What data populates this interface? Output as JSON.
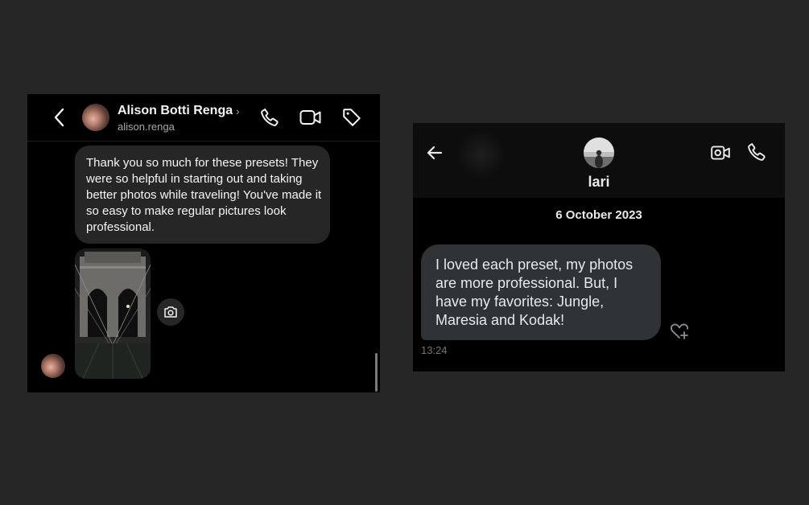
{
  "instagram_dm": {
    "header": {
      "contact_name": "Alison Botti Renga",
      "chevron": "›",
      "username": "alison.renga",
      "icons": [
        "back-chevron-icon",
        "phone-icon",
        "video-camera-icon",
        "tag-icon"
      ]
    },
    "messages": [
      {
        "type": "text",
        "text": "Thank you so much for these presets! They were so helpful in starting out and taking better photos while traveling! You've made it so easy to make regular pictures look professional."
      },
      {
        "type": "photo",
        "description": "night photo of bridge walkway",
        "action_icon": "camera-icon"
      }
    ]
  },
  "x_dm": {
    "header": {
      "contact_name": "lari",
      "icons": [
        "back-arrow-icon",
        "video-camera-icon",
        "phone-icon"
      ]
    },
    "date_separator": "6 October 2023",
    "messages": [
      {
        "text": "I loved each preset, my photos are more professional. But, I have my favorites: Jungle, Maresia and Kodak!",
        "time": "13:24",
        "reaction_icon": "heart-plus-icon"
      }
    ]
  },
  "colors": {
    "page_background": "#262626",
    "panel_background": "#000000",
    "ig_bubble": "#262626",
    "x_bubble": "#2f3336",
    "x_muted_text": "#71767b"
  }
}
